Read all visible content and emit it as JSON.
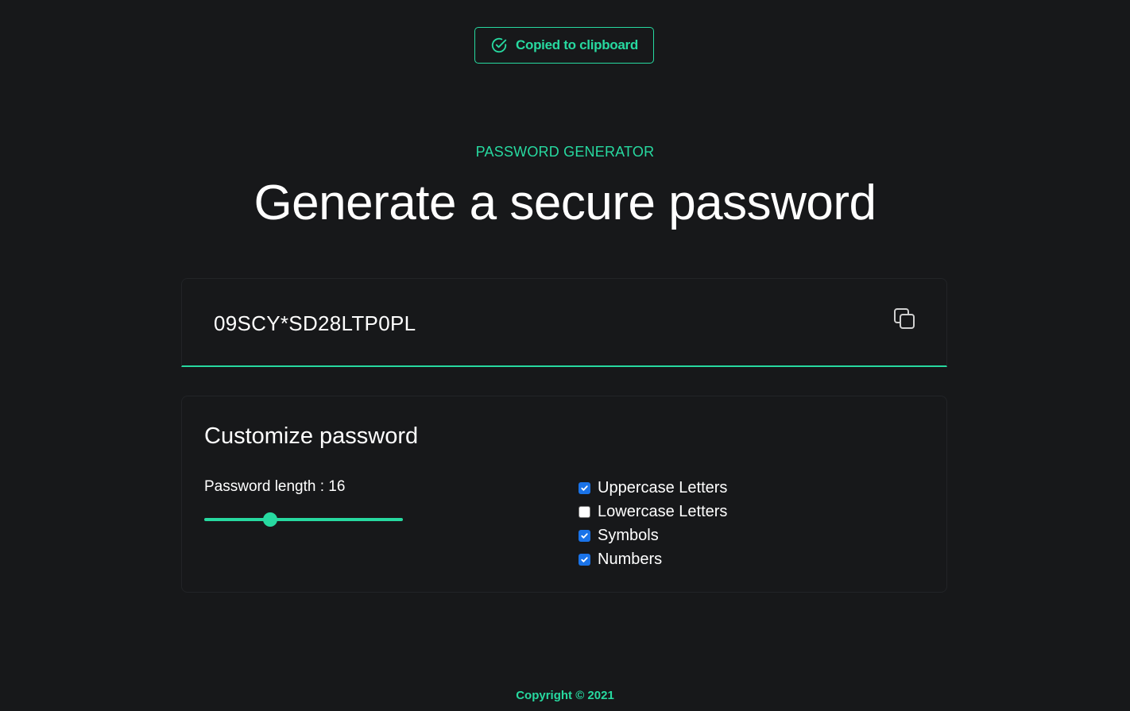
{
  "toast": {
    "message": "Copied to clipboard",
    "icon": "check-circle-icon"
  },
  "header": {
    "eyebrow": "PASSWORD GENERATOR",
    "title": "Generate a secure password"
  },
  "output": {
    "password": "09SCY*SD28LTP0PL",
    "copy_icon": "copy-icon"
  },
  "customize": {
    "title": "Customize password",
    "length_label": "Password length : 16",
    "length_value": 16,
    "length_fraction": 0.33,
    "options": [
      {
        "label": "Uppercase Letters",
        "checked": true
      },
      {
        "label": "Lowercase Letters",
        "checked": false
      },
      {
        "label": "Symbols",
        "checked": true
      },
      {
        "label": "Numbers",
        "checked": true
      }
    ]
  },
  "footer": {
    "copyright": "Copyright © 2021"
  },
  "colors": {
    "accent": "#27d9a0",
    "background": "#17181a",
    "checkbox": "#1a73e8"
  }
}
